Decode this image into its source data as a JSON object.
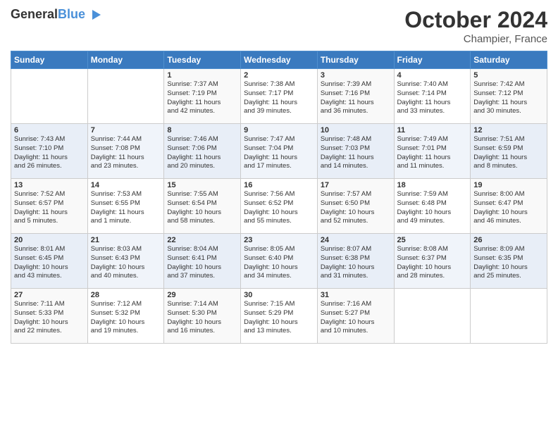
{
  "header": {
    "logo_line1": "General",
    "logo_line2": "Blue",
    "month": "October 2024",
    "location": "Champier, France"
  },
  "days_of_week": [
    "Sunday",
    "Monday",
    "Tuesday",
    "Wednesday",
    "Thursday",
    "Friday",
    "Saturday"
  ],
  "weeks": [
    [
      {
        "day": "",
        "sunrise": "",
        "sunset": "",
        "daylight": ""
      },
      {
        "day": "",
        "sunrise": "",
        "sunset": "",
        "daylight": ""
      },
      {
        "day": "1",
        "sunrise": "Sunrise: 7:37 AM",
        "sunset": "Sunset: 7:19 PM",
        "daylight": "Daylight: 11 hours and 42 minutes."
      },
      {
        "day": "2",
        "sunrise": "Sunrise: 7:38 AM",
        "sunset": "Sunset: 7:17 PM",
        "daylight": "Daylight: 11 hours and 39 minutes."
      },
      {
        "day": "3",
        "sunrise": "Sunrise: 7:39 AM",
        "sunset": "Sunset: 7:16 PM",
        "daylight": "Daylight: 11 hours and 36 minutes."
      },
      {
        "day": "4",
        "sunrise": "Sunrise: 7:40 AM",
        "sunset": "Sunset: 7:14 PM",
        "daylight": "Daylight: 11 hours and 33 minutes."
      },
      {
        "day": "5",
        "sunrise": "Sunrise: 7:42 AM",
        "sunset": "Sunset: 7:12 PM",
        "daylight": "Daylight: 11 hours and 30 minutes."
      }
    ],
    [
      {
        "day": "6",
        "sunrise": "Sunrise: 7:43 AM",
        "sunset": "Sunset: 7:10 PM",
        "daylight": "Daylight: 11 hours and 26 minutes."
      },
      {
        "day": "7",
        "sunrise": "Sunrise: 7:44 AM",
        "sunset": "Sunset: 7:08 PM",
        "daylight": "Daylight: 11 hours and 23 minutes."
      },
      {
        "day": "8",
        "sunrise": "Sunrise: 7:46 AM",
        "sunset": "Sunset: 7:06 PM",
        "daylight": "Daylight: 11 hours and 20 minutes."
      },
      {
        "day": "9",
        "sunrise": "Sunrise: 7:47 AM",
        "sunset": "Sunset: 7:04 PM",
        "daylight": "Daylight: 11 hours and 17 minutes."
      },
      {
        "day": "10",
        "sunrise": "Sunrise: 7:48 AM",
        "sunset": "Sunset: 7:03 PM",
        "daylight": "Daylight: 11 hours and 14 minutes."
      },
      {
        "day": "11",
        "sunrise": "Sunrise: 7:49 AM",
        "sunset": "Sunset: 7:01 PM",
        "daylight": "Daylight: 11 hours and 11 minutes."
      },
      {
        "day": "12",
        "sunrise": "Sunrise: 7:51 AM",
        "sunset": "Sunset: 6:59 PM",
        "daylight": "Daylight: 11 hours and 8 minutes."
      }
    ],
    [
      {
        "day": "13",
        "sunrise": "Sunrise: 7:52 AM",
        "sunset": "Sunset: 6:57 PM",
        "daylight": "Daylight: 11 hours and 5 minutes."
      },
      {
        "day": "14",
        "sunrise": "Sunrise: 7:53 AM",
        "sunset": "Sunset: 6:55 PM",
        "daylight": "Daylight: 11 hours and 1 minute."
      },
      {
        "day": "15",
        "sunrise": "Sunrise: 7:55 AM",
        "sunset": "Sunset: 6:54 PM",
        "daylight": "Daylight: 10 hours and 58 minutes."
      },
      {
        "day": "16",
        "sunrise": "Sunrise: 7:56 AM",
        "sunset": "Sunset: 6:52 PM",
        "daylight": "Daylight: 10 hours and 55 minutes."
      },
      {
        "day": "17",
        "sunrise": "Sunrise: 7:57 AM",
        "sunset": "Sunset: 6:50 PM",
        "daylight": "Daylight: 10 hours and 52 minutes."
      },
      {
        "day": "18",
        "sunrise": "Sunrise: 7:59 AM",
        "sunset": "Sunset: 6:48 PM",
        "daylight": "Daylight: 10 hours and 49 minutes."
      },
      {
        "day": "19",
        "sunrise": "Sunrise: 8:00 AM",
        "sunset": "Sunset: 6:47 PM",
        "daylight": "Daylight: 10 hours and 46 minutes."
      }
    ],
    [
      {
        "day": "20",
        "sunrise": "Sunrise: 8:01 AM",
        "sunset": "Sunset: 6:45 PM",
        "daylight": "Daylight: 10 hours and 43 minutes."
      },
      {
        "day": "21",
        "sunrise": "Sunrise: 8:03 AM",
        "sunset": "Sunset: 6:43 PM",
        "daylight": "Daylight: 10 hours and 40 minutes."
      },
      {
        "day": "22",
        "sunrise": "Sunrise: 8:04 AM",
        "sunset": "Sunset: 6:41 PM",
        "daylight": "Daylight: 10 hours and 37 minutes."
      },
      {
        "day": "23",
        "sunrise": "Sunrise: 8:05 AM",
        "sunset": "Sunset: 6:40 PM",
        "daylight": "Daylight: 10 hours and 34 minutes."
      },
      {
        "day": "24",
        "sunrise": "Sunrise: 8:07 AM",
        "sunset": "Sunset: 6:38 PM",
        "daylight": "Daylight: 10 hours and 31 minutes."
      },
      {
        "day": "25",
        "sunrise": "Sunrise: 8:08 AM",
        "sunset": "Sunset: 6:37 PM",
        "daylight": "Daylight: 10 hours and 28 minutes."
      },
      {
        "day": "26",
        "sunrise": "Sunrise: 8:09 AM",
        "sunset": "Sunset: 6:35 PM",
        "daylight": "Daylight: 10 hours and 25 minutes."
      }
    ],
    [
      {
        "day": "27",
        "sunrise": "Sunrise: 7:11 AM",
        "sunset": "Sunset: 5:33 PM",
        "daylight": "Daylight: 10 hours and 22 minutes."
      },
      {
        "day": "28",
        "sunrise": "Sunrise: 7:12 AM",
        "sunset": "Sunset: 5:32 PM",
        "daylight": "Daylight: 10 hours and 19 minutes."
      },
      {
        "day": "29",
        "sunrise": "Sunrise: 7:14 AM",
        "sunset": "Sunset: 5:30 PM",
        "daylight": "Daylight: 10 hours and 16 minutes."
      },
      {
        "day": "30",
        "sunrise": "Sunrise: 7:15 AM",
        "sunset": "Sunset: 5:29 PM",
        "daylight": "Daylight: 10 hours and 13 minutes."
      },
      {
        "day": "31",
        "sunrise": "Sunrise: 7:16 AM",
        "sunset": "Sunset: 5:27 PM",
        "daylight": "Daylight: 10 hours and 10 minutes."
      },
      {
        "day": "",
        "sunrise": "",
        "sunset": "",
        "daylight": ""
      },
      {
        "day": "",
        "sunrise": "",
        "sunset": "",
        "daylight": ""
      }
    ]
  ]
}
